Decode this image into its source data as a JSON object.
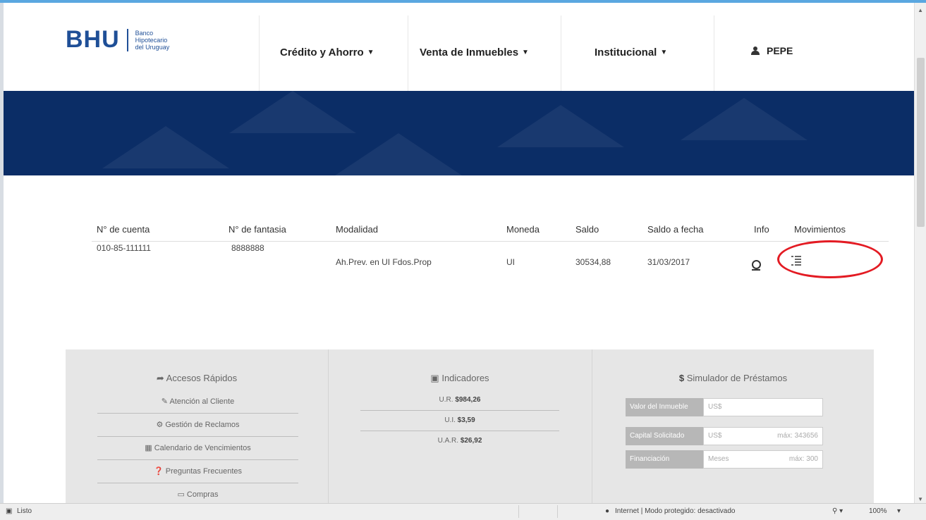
{
  "brand": {
    "logo_text": "BHU",
    "logo_sub_1": "Banco",
    "logo_sub_2": "Hipotecario",
    "logo_sub_3": "del Uruguay"
  },
  "nav": {
    "items": [
      {
        "label": "Crédito y Ahorro"
      },
      {
        "label": "Venta de Inmuebles"
      },
      {
        "label": "Institucional"
      }
    ],
    "user": "PEPE"
  },
  "accounts": {
    "headers": [
      "N° de cuenta",
      "N° de fantasia",
      "Modalidad",
      "Moneda",
      "Saldo",
      "Saldo a fecha",
      "Info",
      "Movimientos"
    ],
    "rows": [
      {
        "cuenta": "010-85-111111",
        "fantasia": "8888888",
        "modalidad": "Ah.Prev. en UI Fdos.Prop",
        "moneda": "UI",
        "saldo": "30534,88",
        "fecha": "31/03/2017"
      }
    ]
  },
  "quick_access": {
    "title": "Accesos Rápidos",
    "links": [
      "Atención al Cliente",
      "Gestión de Reclamos",
      "Calendario de Vencimientos",
      "Preguntas Frecuentes",
      "Compras"
    ]
  },
  "indicators": {
    "title": "Indicadores",
    "rows": [
      {
        "label": "U.R.",
        "value": "$984,26"
      },
      {
        "label": "U.I.",
        "value": "$3,59"
      },
      {
        "label": "U.A.R.",
        "value": "$26,92"
      }
    ]
  },
  "simulator": {
    "title": "Simulador de Préstamos",
    "fields": [
      {
        "label": "Valor del Inmueble",
        "placeholder": "US$",
        "hint": ""
      },
      {
        "label": "Capital Solicitado",
        "placeholder": "US$",
        "hint": "máx: 343656"
      },
      {
        "label": "Financiación",
        "placeholder": "Meses",
        "hint": "máx: 300"
      }
    ]
  },
  "statusbar": {
    "left": "Listo",
    "zone": "Internet | Modo protegido: desactivado",
    "zoom": "100%"
  },
  "colors": {
    "brand_blue": "#1f4f97",
    "banner": "#0b2d66",
    "highlight": "#e31b23"
  }
}
